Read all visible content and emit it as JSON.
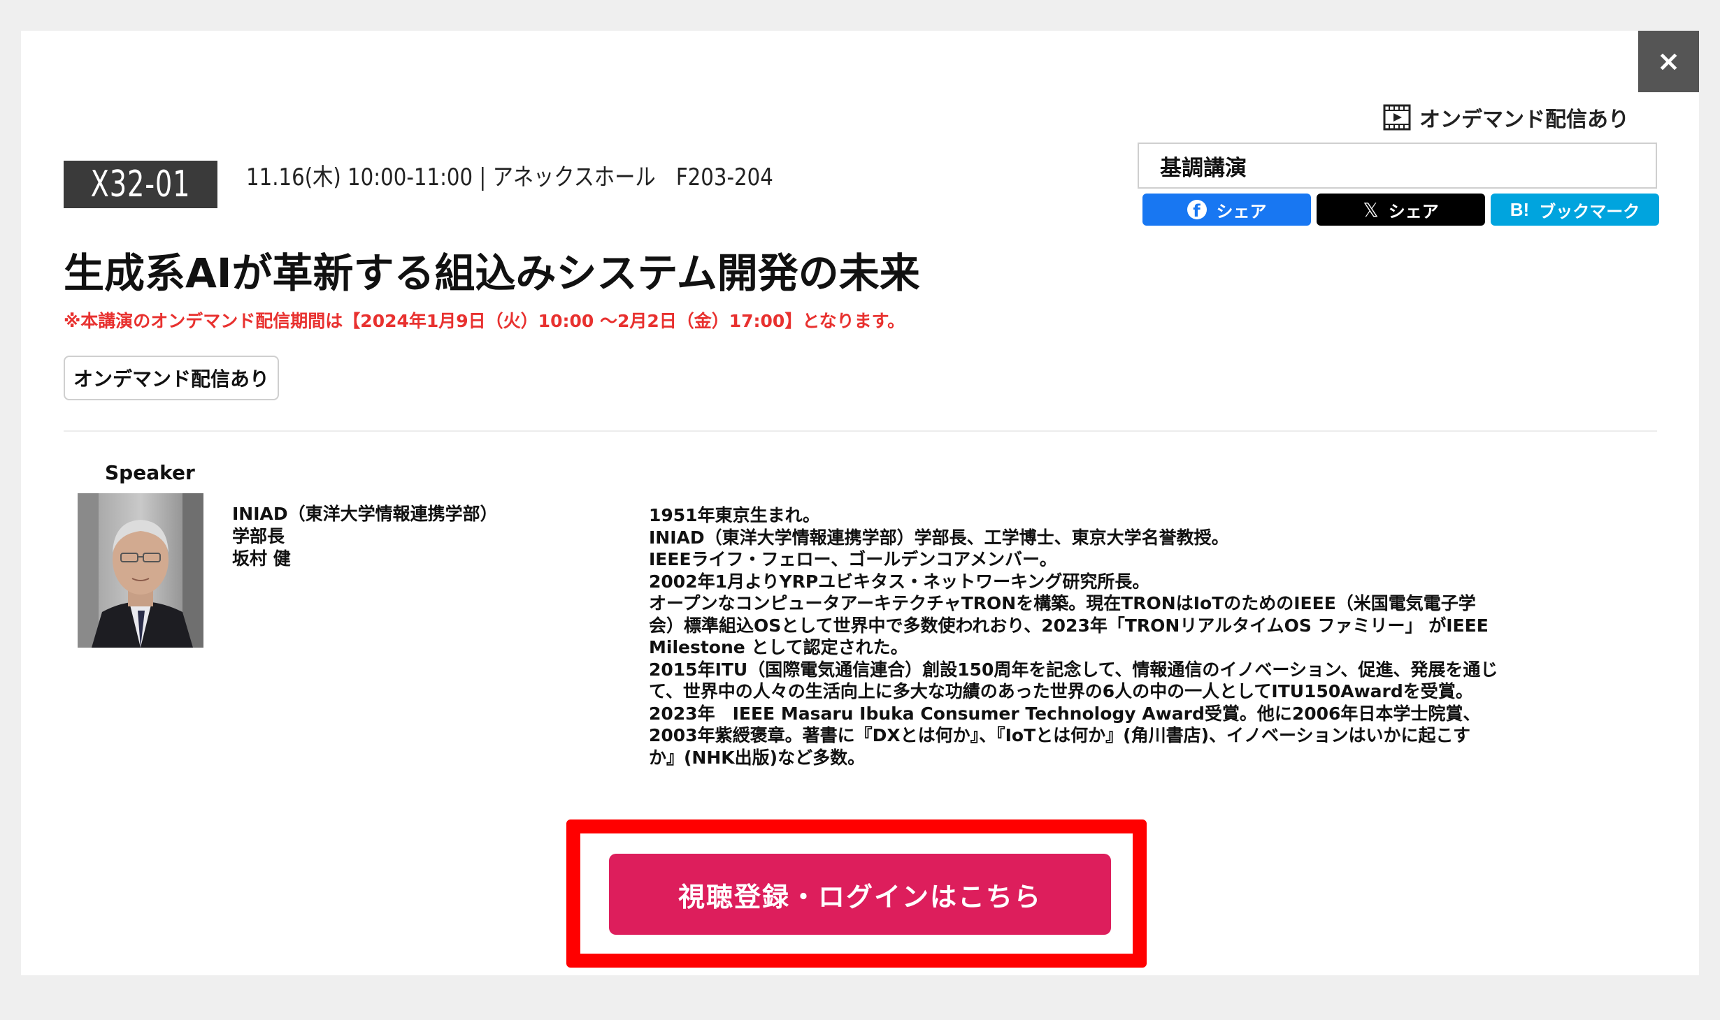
{
  "dialog": {
    "close_label": "×"
  },
  "ondemand_top_label": "オンデマンド配信あり",
  "category": "基調講演",
  "share": {
    "facebook_label": "シェア",
    "x_label": "シェア",
    "hatena_icon_text": "B!",
    "hatena_label": "ブックマーク"
  },
  "session": {
    "code": "X32-01",
    "meta": "11.16(木) 10:00-11:00 | アネックスホール　F203-204",
    "title": "生成系AIが革新する組込みシステム開発の未来",
    "notice": "※本講演のオンデマンド配信期間は【2024年1月9日（火）10:00 〜2月2日（金）17:00】となります。",
    "ondemand_tag": "オンデマンド配信あり"
  },
  "speaker": {
    "section_label": "Speaker",
    "affiliation": "INIAD（東洋大学情報連携学部）",
    "position": "学部長",
    "name": "坂村 健",
    "bio_lines": [
      "1951年東京生まれ。",
      "INIAD（東洋大学情報連携学部）学部長、工学博士、東京大学名誉教授。",
      "IEEEライフ・フェロー、ゴールデンコアメンバー。",
      "2002年1月よりYRPユビキタス・ネットワーキング研究所長。",
      "オープンなコンピュータアーキテクチャTRONを構築。現在TRONはIoTのためのIEEE（米国電気電子学",
      "会）標準組込OSとして世界中で多数使われおり、2023年「TRONリアルタイムOS ファミリー」 がIEEE",
      "Milestone として認定された。",
      "2015年ITU（国際電気通信連合）創設150周年を記念して、情報通信のイノベーション、促進、発展を通じ",
      "て、世界中の人々の生活向上に多大な功績のあった世界の6人の中の一人としてITU150Awardを受賞。",
      "2023年　IEEE Masaru Ibuka Consumer Technology Award受賞。他に2006年日本学士院賞、",
      "2003年紫綬褒章。著書に『DXとは何か』、『IoTとは何か』(角川書店)、イノベーションはいかに起こす",
      "か』(NHK出版)など多数。"
    ]
  },
  "login_button_label": "視聴登録・ログインはこちら",
  "colors": {
    "code_bg": "#3a3a3a",
    "notice": "#e8312f",
    "login_button": "#dd1e5c",
    "highlight": "#ff0000",
    "facebook": "#1877f2",
    "x": "#000000",
    "hatena": "#00a4de"
  }
}
